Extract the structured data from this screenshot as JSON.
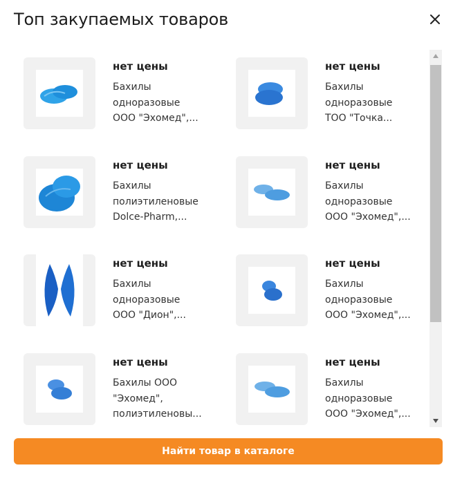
{
  "dialog": {
    "title": "Топ закупаемых товаров",
    "close_icon": "close-icon"
  },
  "products": [
    {
      "price": "нет цены",
      "name_lines": [
        "Бахилы",
        "одноразовые",
        "ООО \"Эхомед\",..."
      ],
      "image": "shoe-covers-image"
    },
    {
      "price": "нет цены",
      "name_lines": [
        "Бахилы",
        "одноразовые",
        "ТОО \"Точка..."
      ],
      "image": "shoe-covers-image"
    },
    {
      "price": "нет цены",
      "name_lines": [
        "Бахилы",
        "полиэтиленовые",
        "Dolce-Pharm,..."
      ],
      "image": "shoe-covers-image"
    },
    {
      "price": "нет цены",
      "name_lines": [
        "Бахилы",
        "одноразовые",
        "ООО \"Эхомед\",..."
      ],
      "image": "shoe-covers-image"
    },
    {
      "price": "нет цены",
      "name_lines": [
        "Бахилы",
        "одноразовые",
        "ООО \"Дион\",..."
      ],
      "image": "shoe-covers-image"
    },
    {
      "price": "нет цены",
      "name_lines": [
        "Бахилы",
        "одноразовые",
        "ООО \"Эхомед\",..."
      ],
      "image": "shoe-covers-image"
    },
    {
      "price": "нет цены",
      "name_lines": [
        "Бахилы ООО",
        "\"Эхомед\",",
        "полиэтиленовы..."
      ],
      "image": "shoe-covers-image"
    },
    {
      "price": "нет цены",
      "name_lines": [
        "Бахилы",
        "одноразовые",
        "ООО \"Эхомед\",..."
      ],
      "image": "shoe-covers-image"
    }
  ],
  "cta": {
    "label": "Найти товар в каталоге"
  },
  "colors": {
    "accent": "#f58a23",
    "cover_blue": "#2f8fe0"
  }
}
